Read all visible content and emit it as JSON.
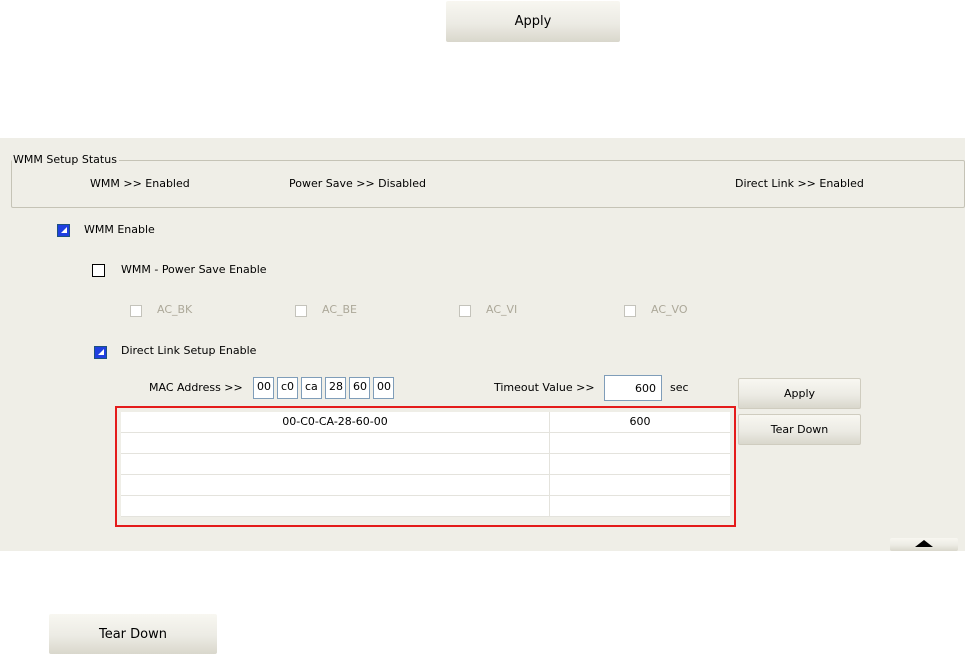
{
  "top_apply_button": {
    "label": "Apply"
  },
  "wmm_status": {
    "title": "WMM Setup Status",
    "wmm": "WMM >> Enabled",
    "power_save": "Power Save >> Disabled",
    "direct_link": "Direct Link >> Enabled"
  },
  "wmm_enable": {
    "label": "WMM Enable",
    "checked": true
  },
  "power_save_enable": {
    "label": "WMM - Power Save Enable",
    "checked": false
  },
  "ac_options": [
    {
      "label": "AC_BK",
      "checked": false,
      "enabled": false
    },
    {
      "label": "AC_BE",
      "checked": false,
      "enabled": false
    },
    {
      "label": "AC_VI",
      "checked": false,
      "enabled": false
    },
    {
      "label": "AC_VO",
      "checked": false,
      "enabled": false
    }
  ],
  "direct_link_setup": {
    "label": "Direct Link Setup Enable",
    "checked": true,
    "mac_label": "MAC Address >>",
    "mac_octets": [
      "00",
      "c0",
      "ca",
      "28",
      "60",
      "00"
    ],
    "timeout_label": "Timeout Value >>",
    "timeout_value": "600",
    "timeout_unit": "sec",
    "apply_label": "Apply",
    "teardown_label": "Tear Down"
  },
  "link_list": {
    "rows": [
      {
        "mac": "00-C0-CA-28-60-00",
        "timeout": "600"
      },
      {
        "mac": "",
        "timeout": ""
      },
      {
        "mac": "",
        "timeout": ""
      },
      {
        "mac": "",
        "timeout": ""
      },
      {
        "mac": "",
        "timeout": ""
      }
    ]
  },
  "collapse_icon": "up-triangle-icon",
  "bottom_teardown_button": {
    "label": "Tear Down"
  }
}
